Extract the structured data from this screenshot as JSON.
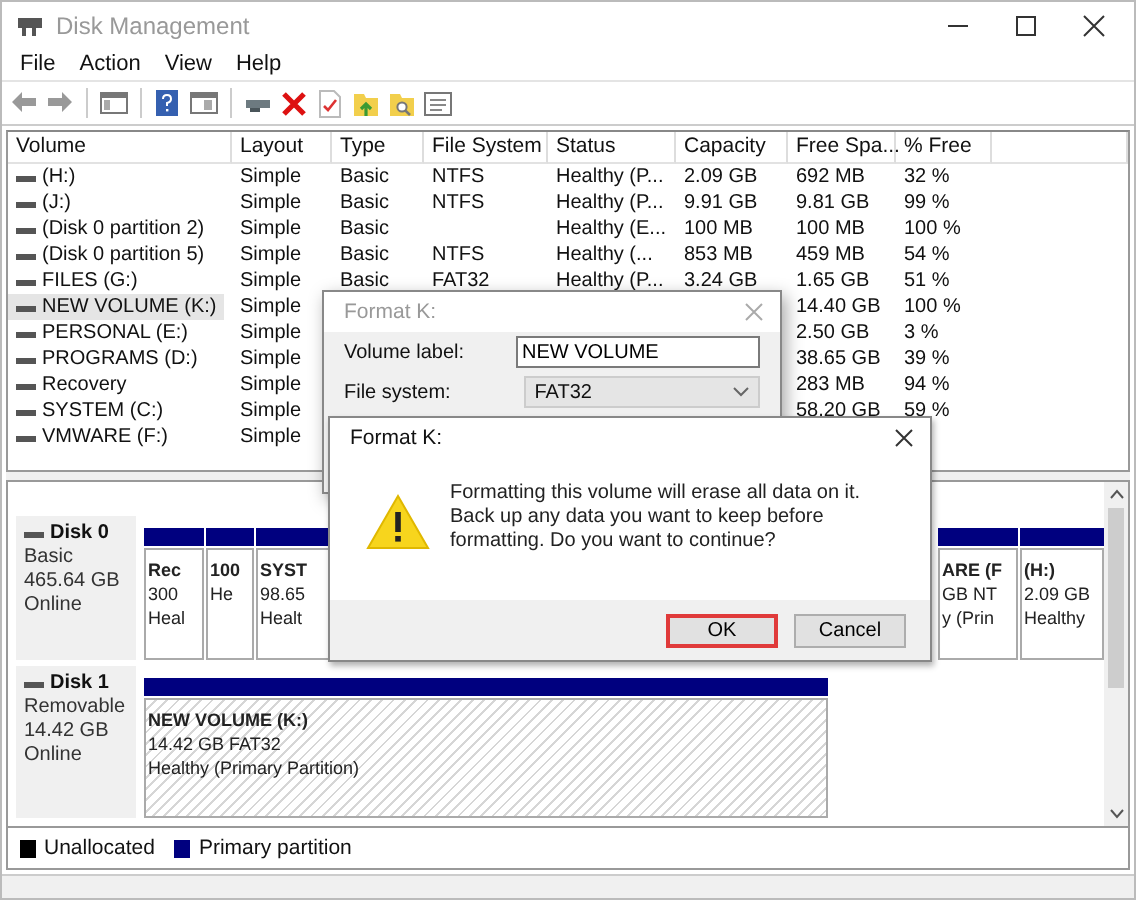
{
  "window": {
    "title": "Disk Management"
  },
  "menu": [
    "File",
    "Action",
    "View",
    "Help"
  ],
  "volumes": {
    "columns": [
      "Volume",
      "Layout",
      "Type",
      "File System",
      "Status",
      "Capacity",
      "Free Spa...",
      "% Free"
    ],
    "rows": [
      {
        "volume": "(H:)",
        "layout": "Simple",
        "type": "Basic",
        "file_system": "NTFS",
        "status": "Healthy (P...",
        "capacity": "2.09 GB",
        "free_space": "692 MB",
        "percent_free": "32 %",
        "selected": false
      },
      {
        "volume": "(J:)",
        "layout": "Simple",
        "type": "Basic",
        "file_system": "NTFS",
        "status": "Healthy (P...",
        "capacity": "9.91 GB",
        "free_space": "9.81 GB",
        "percent_free": "99 %",
        "selected": false
      },
      {
        "volume": "(Disk 0 partition 2)",
        "layout": "Simple",
        "type": "Basic",
        "status": "Healthy (E...",
        "capacity": "100 MB",
        "free_space": "100 MB",
        "percent_free": "100 %",
        "selected": false
      },
      {
        "volume": "(Disk 0 partition 5)",
        "layout": "Simple",
        "type": "Basic",
        "file_system": "NTFS",
        "status": "Healthy (...",
        "capacity": "853 MB",
        "free_space": "459 MB",
        "percent_free": "54 %",
        "selected": false
      },
      {
        "volume": "FILES (G:)",
        "layout": "Simple",
        "type": "Basic",
        "file_system": "FAT32",
        "status": "Healthy (P...",
        "capacity": "3.24 GB",
        "free_space": "1.65 GB",
        "percent_free": "51 %",
        "selected": false
      },
      {
        "volume": "NEW VOLUME (K:)",
        "layout": "Simple",
        "free_space": "14.40 GB",
        "percent_free": "100 %",
        "selected": true
      },
      {
        "volume": "PERSONAL (E:)",
        "layout": "Simple",
        "free_space": "2.50 GB",
        "percent_free": "3 %",
        "selected": false
      },
      {
        "volume": "PROGRAMS (D:)",
        "layout": "Simple",
        "free_space": "38.65 GB",
        "percent_free": "39 %",
        "selected": false
      },
      {
        "volume": "Recovery",
        "layout": "Simple",
        "free_space": "283 MB",
        "percent_free": "94 %",
        "selected": false
      },
      {
        "volume": "SYSTEM (C:)",
        "layout": "Simple",
        "free_space": "58.20 GB",
        "percent_free": "59 %",
        "selected": false
      },
      {
        "volume": "VMWARE (F:)",
        "layout": "Simple",
        "selected": false
      }
    ]
  },
  "disks": [
    {
      "name": "Disk 0",
      "lines": [
        "Basic",
        "465.64 GB",
        "Online"
      ],
      "partitions": [
        {
          "lines": [
            "Rec",
            "300",
            "Heal"
          ],
          "selected": false
        },
        {
          "lines": [
            "100",
            "He"
          ],
          "selected": false
        },
        {
          "lines": [
            "SYST",
            "98.65",
            "Healt"
          ],
          "selected": false
        },
        {
          "lines": [
            "ARE (F",
            "GB NT",
            "y (Prin"
          ],
          "selected": false
        },
        {
          "lines": [
            "(H:)",
            "2.09 GB",
            "Healthy"
          ],
          "selected": false
        }
      ]
    },
    {
      "name": "Disk 1",
      "lines": [
        "Removable",
        "14.42 GB",
        "Online"
      ],
      "partitions": [
        {
          "lines": [
            "NEW VOLUME  (K:)",
            "14.42 GB FAT32",
            "Healthy (Primary Partition)"
          ],
          "selected": true
        }
      ]
    }
  ],
  "legend": [
    {
      "label": "Unallocated",
      "color": "#000000"
    },
    {
      "label": "Primary partition",
      "color": "#00007f"
    }
  ],
  "format_dialog": {
    "title": "Format K:",
    "active": false,
    "fields": [
      {
        "label": "Volume label:",
        "value": "NEW VOLUME",
        "kind": "text"
      },
      {
        "label": "File system:",
        "value": "FAT32",
        "kind": "select"
      }
    ]
  },
  "confirm_dialog": {
    "title": "Format K:",
    "active": true,
    "message": "Formatting this volume will erase all data on it. Back up any data you want to keep before formatting. Do you want to continue?",
    "buttons": [
      {
        "label": "OK",
        "highlighted": true
      },
      {
        "label": "Cancel",
        "highlighted": false
      }
    ]
  }
}
